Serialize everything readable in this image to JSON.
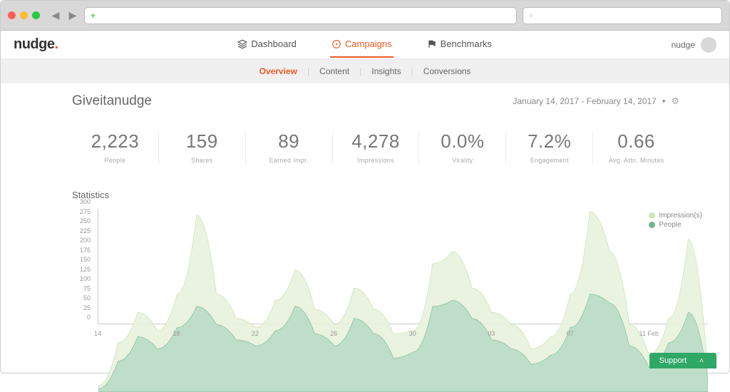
{
  "chrome": {
    "address_placeholder": "+",
    "search_placeholder": ""
  },
  "logo": {
    "text": "nudge",
    "dot": "."
  },
  "nav": {
    "dashboard": "Dashboard",
    "campaigns": "Campaigns",
    "benchmarks": "Benchmarks"
  },
  "user": {
    "name": "nudge"
  },
  "subtabs": {
    "overview": "Overview",
    "content": "Content",
    "insights": "Insights",
    "conversions": "Conversions"
  },
  "campaign": {
    "title": "Giveitanudge",
    "date_range": "January 14, 2017 - February 14, 2017"
  },
  "metrics": {
    "people": {
      "value": "2,223",
      "label": "People"
    },
    "shares": {
      "value": "159",
      "label": "Shares"
    },
    "earned": {
      "value": "89",
      "label": "Earned Impr."
    },
    "impressions": {
      "value": "4,278",
      "label": "Impressions"
    },
    "virality": {
      "value": "0.0%",
      "label": "Virality"
    },
    "engagement": {
      "value": "7.2%",
      "label": "Engagement"
    },
    "attention": {
      "value": "0.66",
      "label": "Avg. Attn. Minutes"
    }
  },
  "stats_heading": "Statistics",
  "legend": {
    "impressions": "Impression(s)",
    "people": "People"
  },
  "support": {
    "label": "Support"
  },
  "colors": {
    "accent": "#f05a28",
    "series_impressions": "#e8f2dc",
    "series_impressions_stroke": "#cfe5b8",
    "series_people": "#b7d9c6",
    "series_people_stroke": "#8fc4a6",
    "support": "#2fa866"
  },
  "chart_data": {
    "type": "area",
    "title": "Statistics",
    "xlabel": "",
    "ylabel": "",
    "ylim": [
      0,
      300
    ],
    "y_ticks": [
      0,
      25,
      50,
      75,
      100,
      125,
      150,
      175,
      200,
      225,
      250,
      275,
      300
    ],
    "x_tick_labels": [
      "14",
      "18",
      "22",
      "26",
      "30",
      "03",
      "07",
      "11 Feb"
    ],
    "x_tick_positions": [
      0,
      4,
      8,
      12,
      16,
      20,
      24,
      28
    ],
    "x": [
      0,
      1,
      2,
      3,
      4,
      5,
      6,
      7,
      8,
      9,
      10,
      11,
      12,
      13,
      14,
      15,
      16,
      17,
      18,
      19,
      20,
      21,
      22,
      23,
      24,
      25,
      26,
      27,
      28,
      29,
      30,
      31
    ],
    "series": [
      {
        "name": "Impression(s)",
        "values": [
          10,
          80,
          130,
          100,
          160,
          290,
          160,
          120,
          105,
          150,
          200,
          135,
          110,
          170,
          135,
          95,
          100,
          210,
          230,
          170,
          130,
          110,
          70,
          90,
          160,
          295,
          230,
          110,
          60,
          120,
          250,
          30
        ]
      },
      {
        "name": "People",
        "values": [
          5,
          50,
          90,
          70,
          105,
          140,
          110,
          85,
          75,
          100,
          140,
          95,
          75,
          120,
          95,
          55,
          65,
          140,
          150,
          120,
          85,
          70,
          45,
          60,
          105,
          160,
          145,
          75,
          40,
          80,
          130,
          20
        ]
      }
    ]
  }
}
